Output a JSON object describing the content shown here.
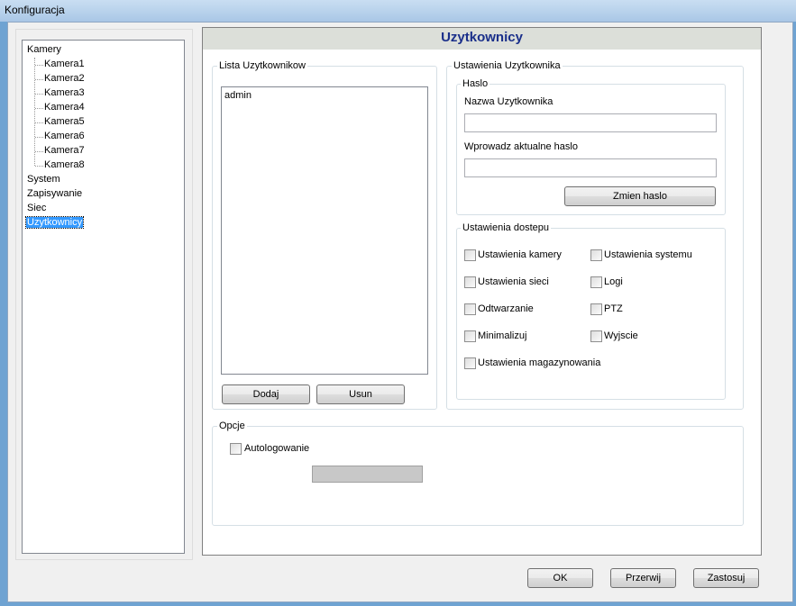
{
  "window": {
    "title": "Konfiguracja"
  },
  "tree": {
    "root": "Kamery",
    "cameras": [
      "Kamera1",
      "Kamera2",
      "Kamera3",
      "Kamera4",
      "Kamera5",
      "Kamera6",
      "Kamera7",
      "Kamera8"
    ],
    "items": [
      "System",
      "Zapisywanie",
      "Siec",
      "Uzytkownicy"
    ],
    "selected": "Uzytkownicy"
  },
  "panel": {
    "header": "Uzytkownicy",
    "user_list": {
      "title": "Lista Uzytkownikow",
      "users": [
        "admin"
      ],
      "add_label": "Dodaj",
      "remove_label": "Usun"
    },
    "user_settings": {
      "title": "Ustawienia Uzytkownika",
      "password_group": {
        "title": "Haslo",
        "username_label": "Nazwa Uzytkownika",
        "username_value": "",
        "password_label": "Wprowadz aktualne haslo",
        "password_value": "",
        "change_label": "Zmien haslo"
      },
      "access_group": {
        "title": "Ustawienia dostepu",
        "options": [
          {
            "label": "Ustawienia kamery",
            "checked": false
          },
          {
            "label": "Ustawienia systemu",
            "checked": false
          },
          {
            "label": "Ustawienia sieci",
            "checked": false
          },
          {
            "label": "Logi",
            "checked": false
          },
          {
            "label": "Odtwarzanie",
            "checked": false
          },
          {
            "label": "PTZ",
            "checked": false
          },
          {
            "label": "Minimalizuj",
            "checked": false
          },
          {
            "label": "Wyjscie",
            "checked": false
          },
          {
            "label": "Ustawienia magazynowania",
            "checked": false
          }
        ]
      }
    },
    "options": {
      "title": "Opcje",
      "autologin_label": "Autologowanie",
      "autologin_checked": false
    }
  },
  "footer": {
    "ok_label": "OK",
    "cancel_label": "Przerwij",
    "apply_label": "Zastosuj"
  }
}
